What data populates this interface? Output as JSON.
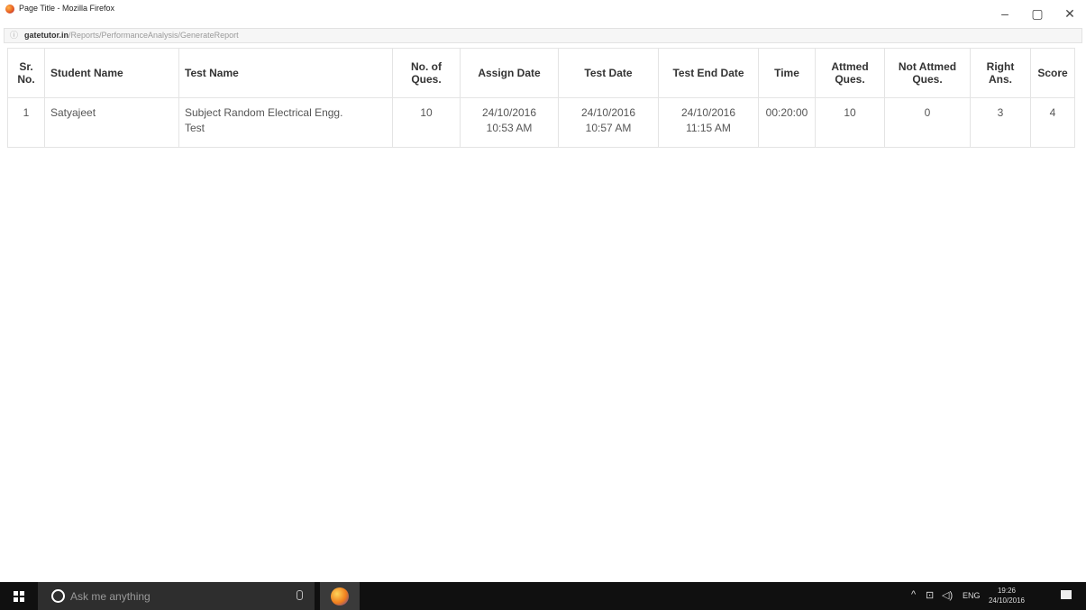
{
  "window": {
    "title": "Page Title - Mozilla Firefox",
    "minimize_glyph": "–",
    "restore_glyph": "▢",
    "close_glyph": "✕"
  },
  "urlbar": {
    "host": "gatetutor.in",
    "path": "/Reports/PerformanceAnalysis/GenerateReport"
  },
  "table": {
    "headers": {
      "sr": [
        "Sr.",
        "No."
      ],
      "student": "Student Name",
      "test": "Test Name",
      "noq": [
        "No. of",
        "Ques."
      ],
      "assign": "Assign Date",
      "tdate": "Test Date",
      "tend": "Test End Date",
      "time": "Time",
      "att": [
        "Attmed",
        "Ques."
      ],
      "natt": [
        "Not Attmed",
        "Ques."
      ],
      "right": [
        "Right",
        "Ans."
      ],
      "score": "Score"
    },
    "rows": [
      {
        "sr": "1",
        "student": "Satyajeet",
        "test": [
          "Subject Random Electrical Engg.",
          "Test"
        ],
        "noq": "10",
        "assign": [
          "24/10/2016",
          "10:53 AM"
        ],
        "tdate": [
          "24/10/2016",
          "10:57 AM"
        ],
        "tend": [
          "24/10/2016",
          "11:15 AM"
        ],
        "time": "00:20:00",
        "att": "10",
        "natt": "0",
        "right": "3",
        "score": "4"
      }
    ]
  },
  "taskbar": {
    "search_placeholder": "Ask me anything",
    "language": "ENG",
    "time": "19:26",
    "date": "24/10/2016"
  }
}
